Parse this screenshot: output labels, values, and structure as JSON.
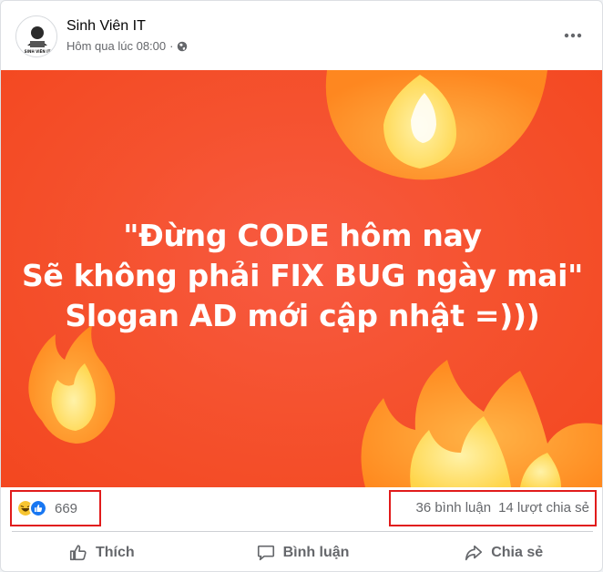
{
  "post": {
    "author": "Sinh Viên IT",
    "time": "Hôm qua lúc 08:00",
    "privacy_icon": "globe-icon",
    "avatar_caption": "SINH VIÊN IT"
  },
  "image": {
    "quote_lines": [
      "\"Đừng CODE hôm nay",
      "Sẽ không phải FIX BUG ngày mai\"",
      "Slogan AD mới cập nhật =)))"
    ]
  },
  "stats": {
    "reaction_icons": [
      "haha-icon",
      "like-icon"
    ],
    "reaction_count": "669",
    "comments": "36 bình luận",
    "shares": "14 lượt chia sẻ"
  },
  "actions": {
    "like": "Thích",
    "comment": "Bình luận",
    "share": "Chia sẻ"
  },
  "colors": {
    "background_orange": "#f5522f",
    "highlight_red": "#e11b1b",
    "text_secondary": "#65676b",
    "like_blue": "#1877f2"
  }
}
